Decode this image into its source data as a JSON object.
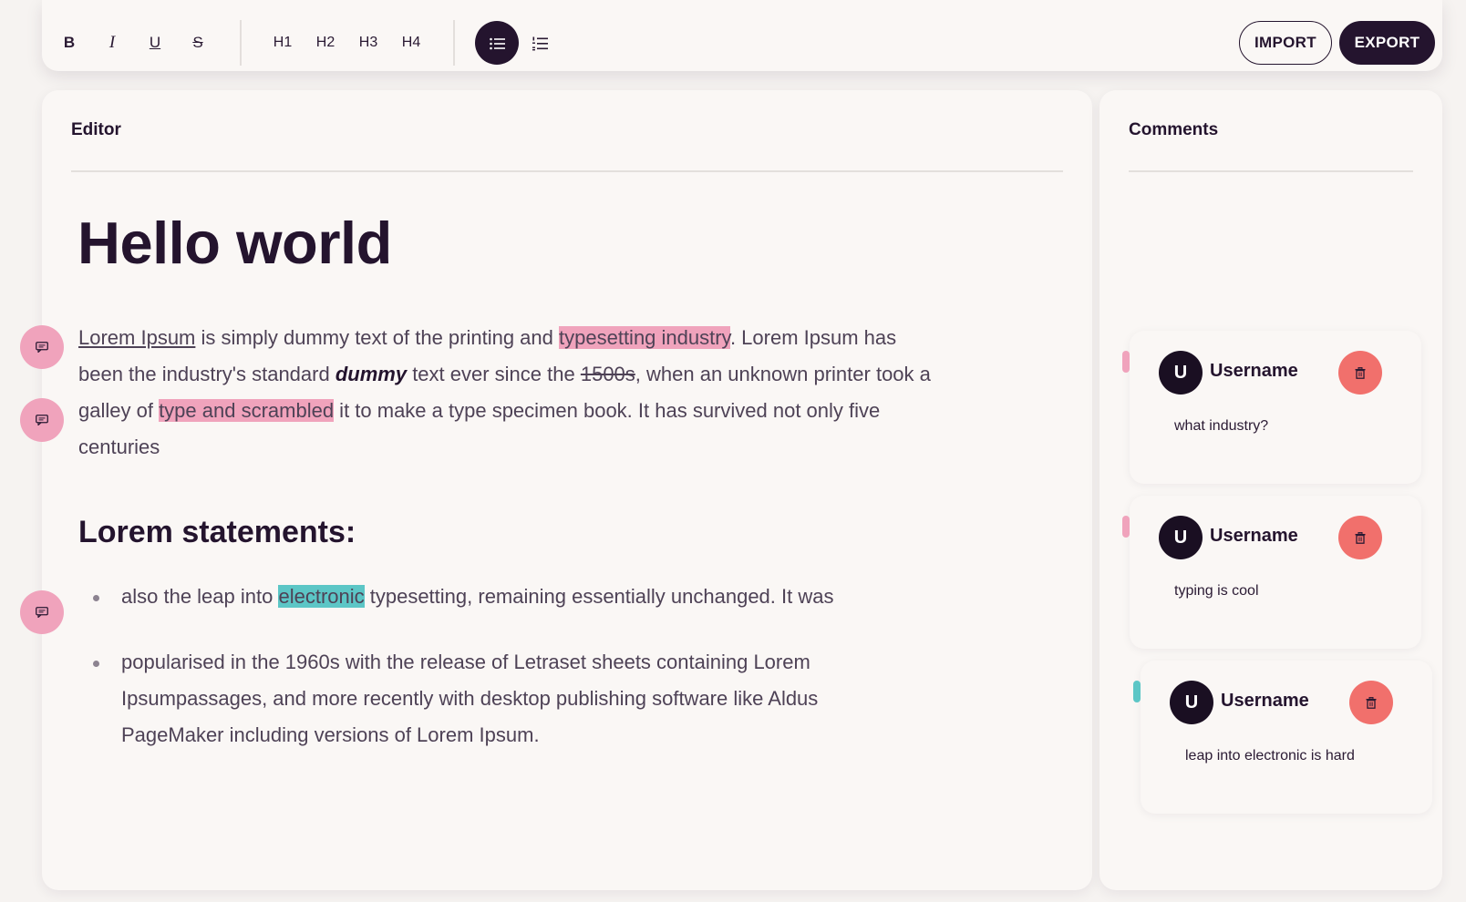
{
  "toolbar": {
    "format_buttons": [
      {
        "label": "B",
        "icon": "bold-icon"
      },
      {
        "label": "I",
        "icon": "italic-icon"
      },
      {
        "label": "U",
        "icon": "underline-icon"
      },
      {
        "label": "S",
        "icon": "strikethrough-icon"
      }
    ],
    "heading_buttons": [
      "H1",
      "H2",
      "H3",
      "H4"
    ],
    "list_buttons": [
      {
        "icon": "bullet-list-icon",
        "active": true
      },
      {
        "icon": "numbered-list-icon",
        "active": false
      }
    ],
    "import_label": "IMPORT",
    "export_label": "EXPORT"
  },
  "editor": {
    "title": "Editor",
    "heading": "Hello world",
    "paragraph": {
      "link_text": "Lorem Ipsum",
      "text1": " is simply dummy text of the printing and ",
      "hl1": "typesetting industry",
      "text2": ". Lorem Ipsum has been the industry's standard ",
      "bold_italic": "dummy",
      "text3": " text ever since the ",
      "strike": "1500s",
      "text4": ", when an unknown printer took a galley of ",
      "hl2": "type and scrambled",
      "text5": " it to make a type specimen book. It has survived not only five centuries"
    },
    "subheading": "Lorem statements:",
    "list": {
      "item1_before": "also the leap into ",
      "item1_hl": "electronic",
      "item1_after": " typesetting, remaining essentially unchanged. It was",
      "item2": "popularised in the 1960s with the release of Letraset sheets containing Lorem Ipsumpassages, and more recently with desktop publishing software like Aldus PageMaker including versions of Lorem Ipsum."
    }
  },
  "comments": {
    "title": "Comments",
    "items": [
      {
        "avatar": "U",
        "username": "Username",
        "text": "what industry?",
        "color": "#f0a3bc"
      },
      {
        "avatar": "U",
        "username": "Username",
        "text": "typing is cool",
        "color": "#f0a3bc"
      },
      {
        "avatar": "U",
        "username": "Username",
        "text": "leap into electronic is hard",
        "color": "#5cc6c6"
      }
    ]
  },
  "colors": {
    "accent_dark": "#24142e",
    "highlight_pink": "#f0a3bc",
    "highlight_teal": "#5cc6c6",
    "delete_red": "#f1706c"
  }
}
